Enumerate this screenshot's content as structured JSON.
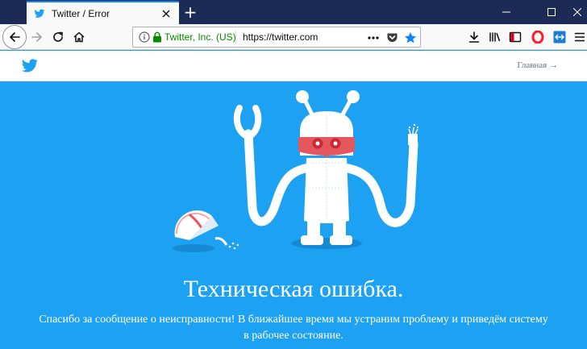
{
  "browser": {
    "tab": {
      "title": "Twitter / Error",
      "favicon": "twitter-bird-icon"
    },
    "url_bar": {
      "identity": "Twitter, Inc. (US)",
      "url": "https://twitter.com",
      "secure": true
    },
    "colors": {
      "tabstrip": "#1c2b55",
      "accent": "#0a84ff",
      "secure_green": "#058b00"
    }
  },
  "site": {
    "logo": "twitter-bird-icon",
    "home_link": "Главная →",
    "colors": {
      "brand": "#1da1f2"
    }
  },
  "error": {
    "illustration": "broken-robot-illustration",
    "title": "Техническая ошибка.",
    "message": "Спасибо за сообщение о неисправности! В ближайшее время мы устраним проблему и приведём систему в рабочее состояние."
  }
}
